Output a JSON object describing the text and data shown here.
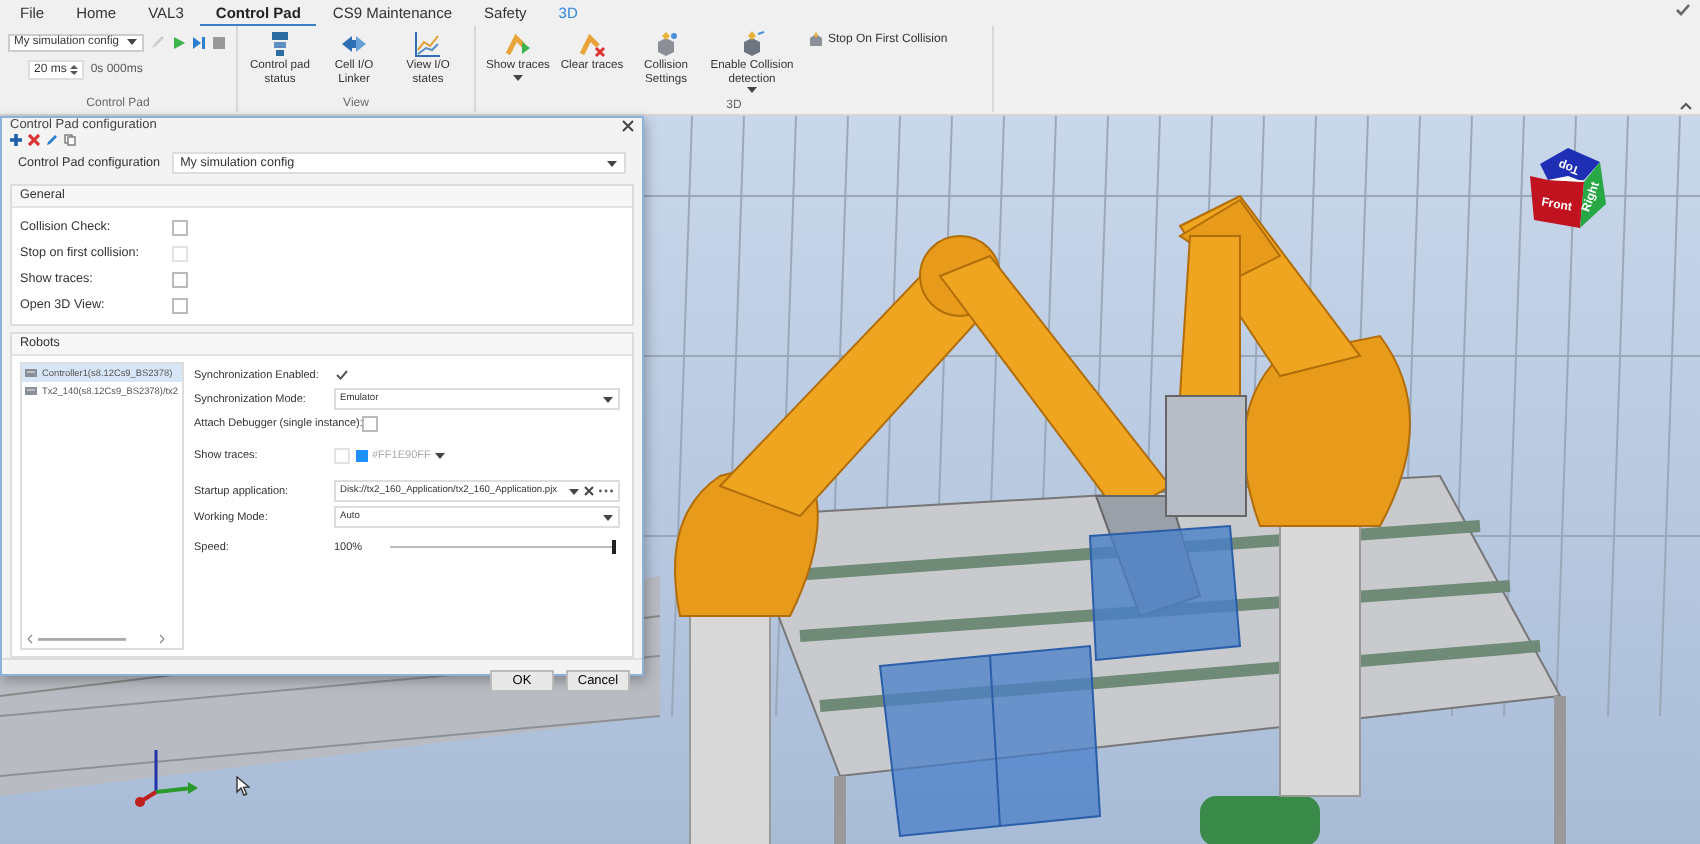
{
  "ribbon": {
    "tabs": [
      {
        "label": "File",
        "selected": false,
        "kind": "normal"
      },
      {
        "label": "Home",
        "selected": false,
        "kind": "normal"
      },
      {
        "label": "VAL3",
        "selected": false,
        "kind": "normal"
      },
      {
        "label": "Control Pad",
        "selected": true,
        "kind": "normal"
      },
      {
        "label": "CS9 Maintenance",
        "selected": false,
        "kind": "normal"
      },
      {
        "label": "Safety",
        "selected": false,
        "kind": "normal"
      },
      {
        "label": "3D",
        "selected": false,
        "kind": "contextual"
      }
    ],
    "control_pad": {
      "label": "Control Pad",
      "config": "My simulation config",
      "interval": "20 ms",
      "time": "0s 000ms"
    },
    "view_group": {
      "label": "View",
      "buttons": [
        {
          "label": "Control pad status"
        },
        {
          "label": "Cell I/O Linker"
        },
        {
          "label": "View I/O states"
        }
      ]
    },
    "group_3d": {
      "label": "3D",
      "buttons": [
        {
          "label": "Show traces",
          "dropdown": true
        },
        {
          "label": "Clear traces",
          "dropdown": false
        },
        {
          "label": "Collision Settings",
          "dropdown": false
        },
        {
          "label": "Enable Collision detection",
          "dropdown": true
        }
      ],
      "stop_button": "Stop On First Collision"
    }
  },
  "dialog": {
    "title": "Control Pad configuration",
    "config_label": "Control Pad configuration",
    "config_value": "My simulation config",
    "general": {
      "title": "General",
      "options": [
        {
          "label": "Collision Check:",
          "checked": false,
          "disabled": false
        },
        {
          "label": "Stop on first collision:",
          "checked": false,
          "disabled": true
        },
        {
          "label": "Show traces:",
          "checked": false,
          "disabled": false
        },
        {
          "label": "Open 3D View:",
          "checked": false,
          "disabled": false
        }
      ]
    },
    "robots": {
      "title": "Robots",
      "items": [
        {
          "label": "Controller1(s8.12Cs9_BS2378)",
          "selected": true
        },
        {
          "label": "Tx2_140(s8.12Cs9_BS2378)/tx2",
          "selected": false
        }
      ],
      "settings": [
        {
          "kind": "checkbox",
          "label": "Synchronization Enabled:",
          "checked": true
        },
        {
          "kind": "select",
          "label": "Synchronization Mode:",
          "value": "Emulator"
        },
        {
          "kind": "checkbox",
          "label": "Attach Debugger (single instance):",
          "checked": false
        },
        {
          "kind": "traces",
          "label": "Show traces:",
          "checked": false,
          "disabled": true,
          "color": "#1e90ff",
          "value": "#FF1E90FF"
        },
        {
          "kind": "file",
          "label": "Startup application:",
          "value": "Disk://tx2_160_Application/tx2_160_Application.pjx"
        },
        {
          "kind": "select",
          "label": "Working Mode:",
          "value": "Auto"
        },
        {
          "kind": "slider",
          "label": "Speed:",
          "value": "100%",
          "level": 1
        }
      ]
    },
    "buttons": [
      "OK",
      "Cancel"
    ]
  },
  "scene": {
    "view_cube": [
      "Top",
      "Front",
      "Right"
    ]
  }
}
